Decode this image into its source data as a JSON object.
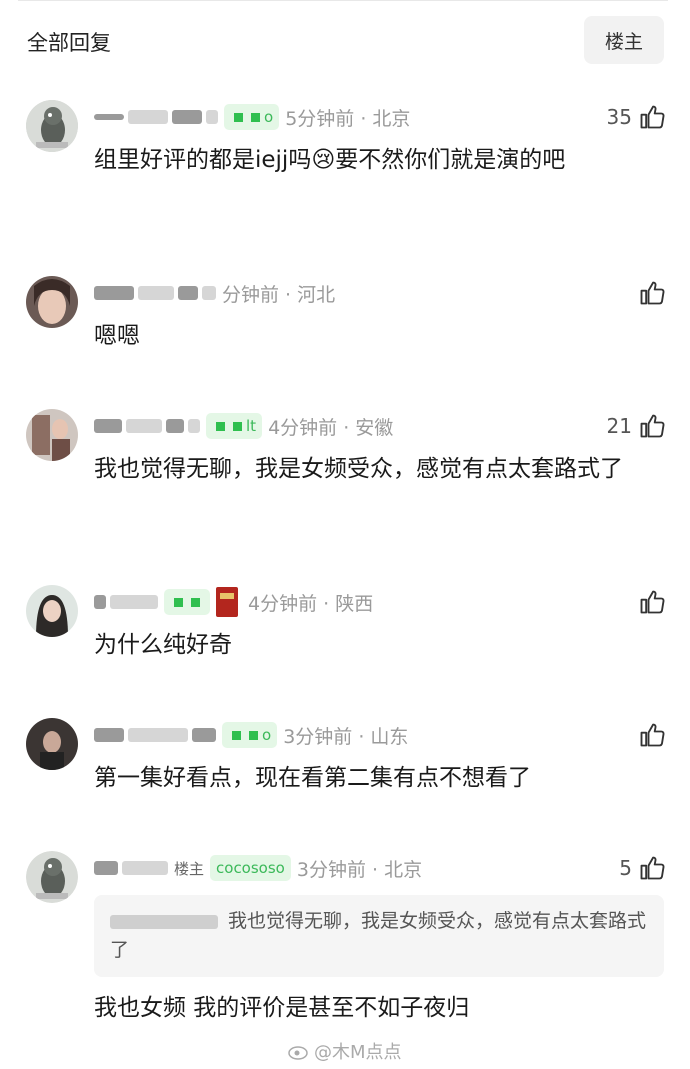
{
  "header": {
    "title": "全部回复",
    "owner_button": "楼主"
  },
  "comments": [
    {
      "time": "5分钟前 · 北京",
      "likes": "35",
      "text": "组里好评的都是iejj吗😢要不然你们就是演的吧",
      "badge": "▪ ▪ o"
    },
    {
      "time": "分钟前 · 河北",
      "likes": "",
      "text": "嗯嗯",
      "badge": ""
    },
    {
      "time": "4分钟前 · 安徽",
      "likes": "21",
      "text": "我也觉得无聊，我是女频受众，感觉有点太套路式了",
      "badge": "▪ ▪ lt"
    },
    {
      "time": "4分钟前 · 陕西",
      "likes": "",
      "text": "为什么纯好奇",
      "badge": ""
    },
    {
      "time": "3分钟前 · 山东",
      "likes": "",
      "text": "第一集好看点，现在看第二集有点不想看了",
      "badge": "▪ ▪ o"
    },
    {
      "time": "3分钟前 · 北京",
      "likes": "5",
      "text": "我也女频 我的评价是甚至不如子夜归",
      "badge": "cocososo",
      "owner_tag": "楼主",
      "quote": "我也觉得无聊，我是女频受众，感觉有点太套路式了"
    }
  ],
  "watermark": "@木M点点",
  "colors": {
    "accent_green": "#3cb95a",
    "badge_bg": "#e4f7e6",
    "meta_gray": "#9a9a9a"
  }
}
